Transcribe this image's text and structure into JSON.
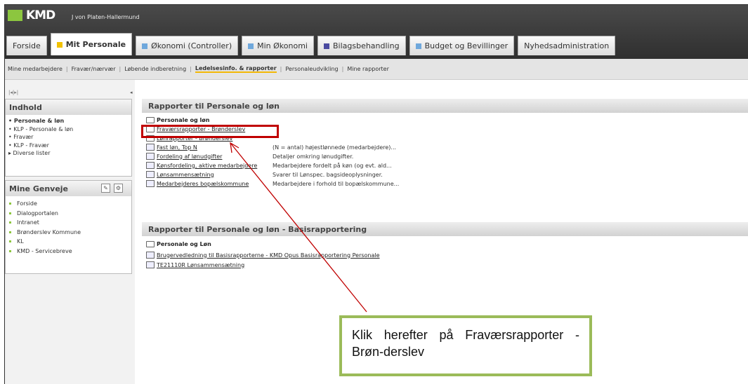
{
  "header": {
    "logo_text": "KMD",
    "user": "J von Platen-Hallermund",
    "tabs": [
      {
        "label": "Forside",
        "color": ""
      },
      {
        "label": "Mit Personale",
        "color": "#f2c200"
      },
      {
        "label": "Økonomi (Controller)",
        "color": "#6fa8dc"
      },
      {
        "label": "Min Økonomi",
        "color": "#6fa8dc"
      },
      {
        "label": "Bilagsbehandling",
        "color": "#4a4aa0"
      },
      {
        "label": "Budget og Bevillinger",
        "color": "#6fa8dc"
      },
      {
        "label": "Nyhedsadministration",
        "color": ""
      }
    ]
  },
  "subnav": {
    "items": [
      "Mine medarbejdere",
      "Fravær/nærvær",
      "Løbende indberetning",
      "Ledelsesinfo. & rapporter",
      "Personaleudvikling",
      "Mine rapporter"
    ]
  },
  "sidebar": {
    "collapse_label": "|◂|▸|",
    "indhold": {
      "title": "Indhold",
      "items": [
        "• Personale & løn",
        "• KLP - Personale & løn",
        "• Fravær",
        "• KLP - Fravær",
        "▸ Diverse lister"
      ]
    },
    "genveje": {
      "title": "Mine Genveje",
      "items": [
        "Forside",
        "Dialogportalen",
        "Intranet",
        "Brønderslev Kommune",
        "KL",
        "KMD - Servicebreve"
      ]
    }
  },
  "panel1": {
    "title": "Rapporter til Personale og løn",
    "folder": "Personale og løn",
    "rows": [
      {
        "label": "Fraværsrapporter - Brønderslev",
        "desc": ""
      },
      {
        "label": "Lønrapporter - Brønderslev",
        "desc": ""
      },
      {
        "label": "Fast løn, Top N",
        "desc": "(N = antal) højestlønnede (medarbejdere)..."
      },
      {
        "label": "Fordeling af lønudgifter",
        "desc": "Detaljer omkring lønudgifter."
      },
      {
        "label": "Kønsfordeling, aktive medarbejdere",
        "desc": "Medarbejdere fordelt på køn (og evt. ald..."
      },
      {
        "label": "Lønsammensætning",
        "desc": "Svarer til Lønspec. bagsideoplysninger."
      },
      {
        "label": "Medarbejderes bopælskommune",
        "desc": "Medarbejdere i forhold til bopælskommune..."
      }
    ]
  },
  "panel2": {
    "title": "Rapporter til Personale og løn - Basisrapportering",
    "folder": "Personale og Løn",
    "rows": [
      {
        "label": "Brugervedledning til Basisrapporterne - KMD Opus Basisrapportering Personale"
      },
      {
        "label": "TE21110R Lønsammensætning"
      }
    ]
  },
  "callout": {
    "text": "Klik herefter på Fraværsrapporter - Brøn-derslev"
  },
  "colors": {
    "highlight": "#c00000",
    "callout_border": "#9bbb59",
    "accent": "#f2b705",
    "logo_green": "#8cc63f"
  }
}
